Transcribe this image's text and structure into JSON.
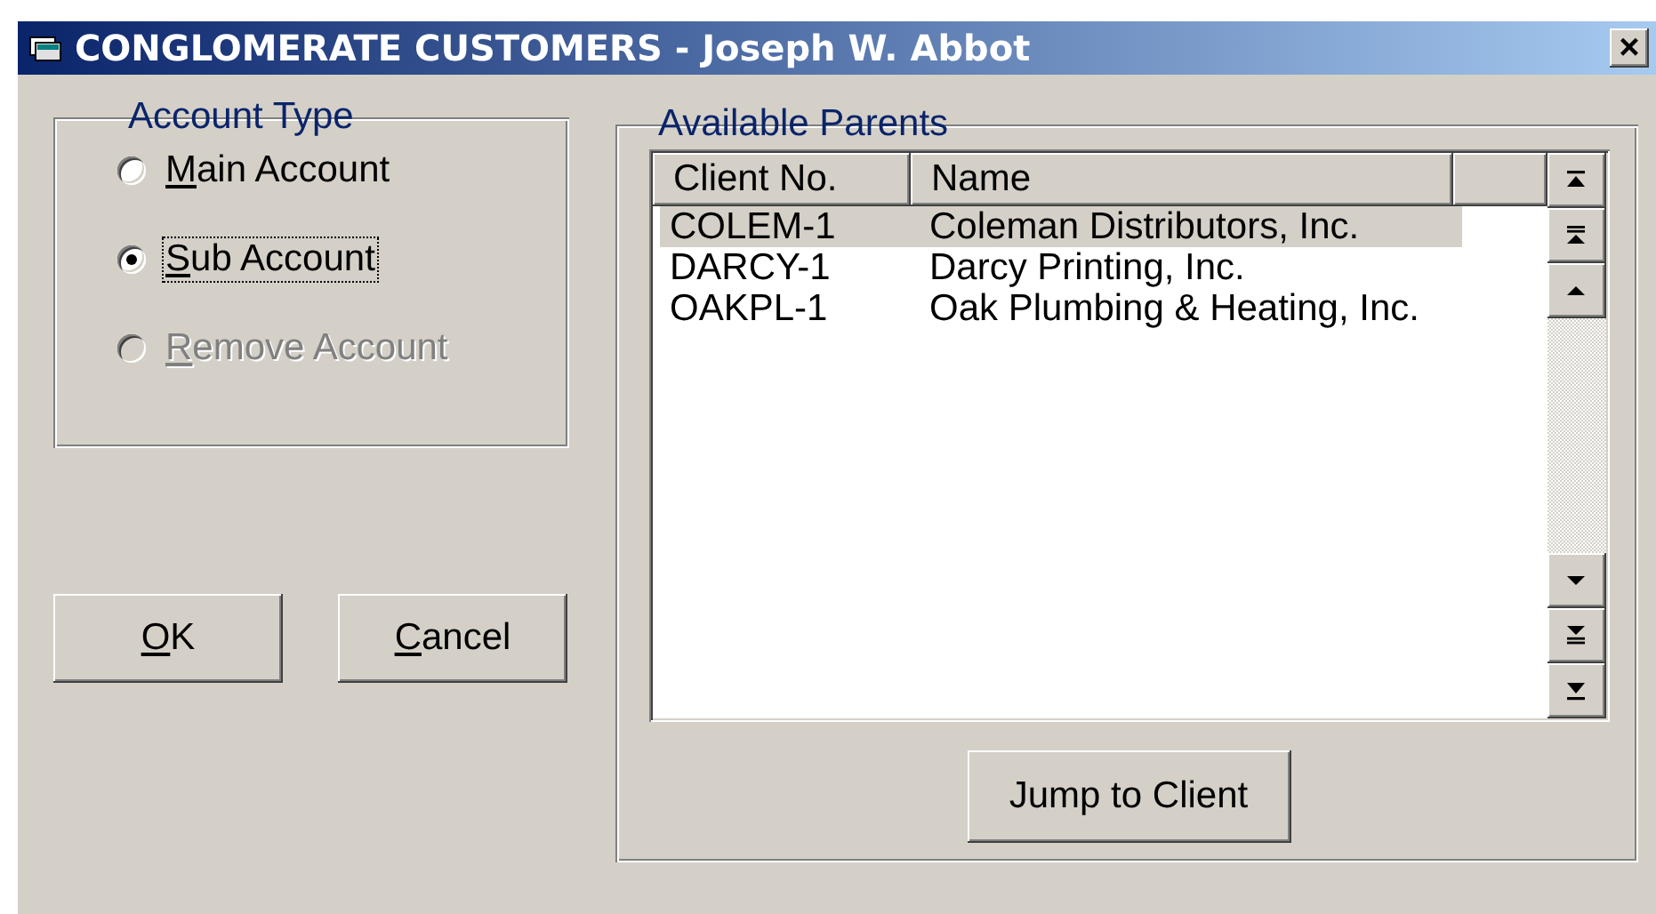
{
  "window": {
    "title": "CONGLOMERATE CUSTOMERS - Joseph W. Abbot",
    "close": "×"
  },
  "account_type": {
    "label": "Account Type",
    "options": [
      {
        "label": "Main Account",
        "selected": false,
        "disabled": false,
        "focused": false,
        "mnemonic": true
      },
      {
        "label": "Sub Account",
        "selected": true,
        "disabled": false,
        "focused": true,
        "mnemonic": true
      },
      {
        "label": "Remove Account",
        "selected": false,
        "disabled": true,
        "focused": false,
        "mnemonic": true
      }
    ]
  },
  "buttons": [
    {
      "label": "OK",
      "mnemonic": true
    },
    {
      "label": "Cancel",
      "mnemonic": true
    }
  ],
  "available_parents": {
    "label": "Available Parents",
    "columns": [
      "Client No.",
      "Name"
    ],
    "rows": [
      {
        "client_no": "COLEM-1",
        "name": "Coleman Distributors, Inc.",
        "selected": true
      },
      {
        "client_no": "DARCY-1",
        "name": "Darcy Printing, Inc.",
        "selected": false
      },
      {
        "client_no": "OAKPL-1",
        "name": "Oak Plumbing & Heating, Inc.",
        "selected": false
      }
    ],
    "jump_button": "Jump to Client"
  }
}
